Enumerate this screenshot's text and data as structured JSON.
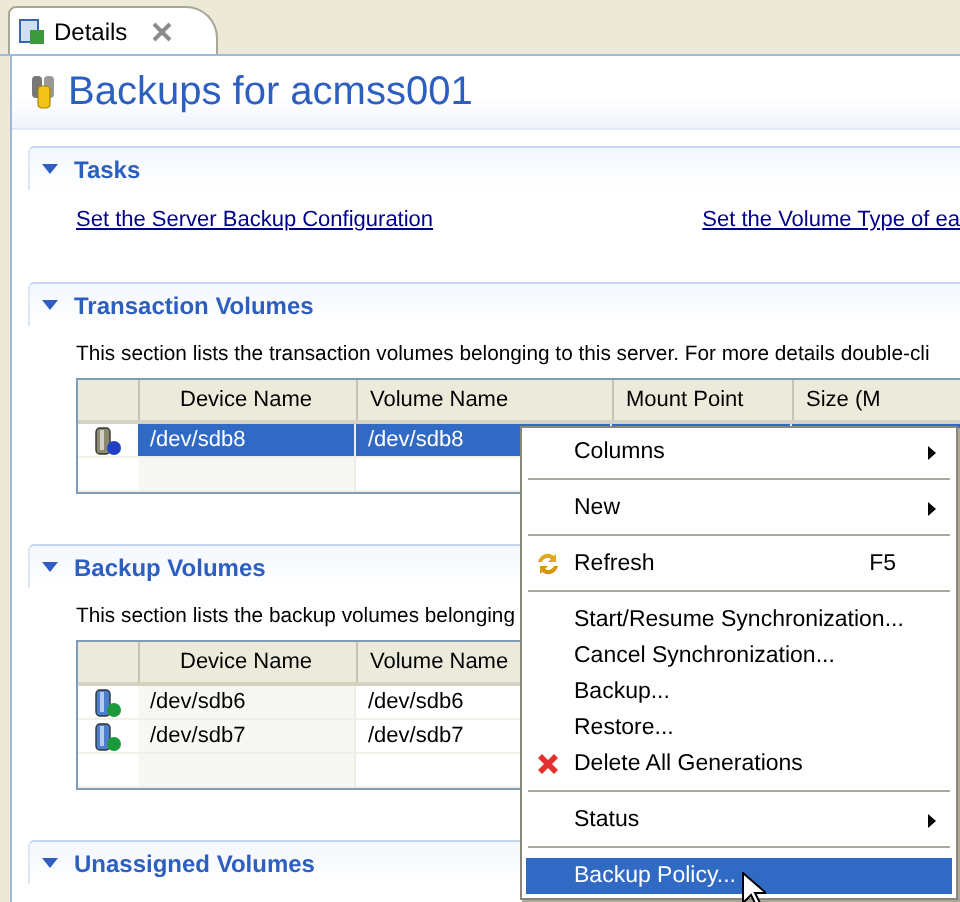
{
  "tab": {
    "label": "Details",
    "selected": true
  },
  "page_title": "Backups for acmss001",
  "sections": [
    {
      "kind": "tasks",
      "title": "Tasks",
      "expanded": true,
      "links": [
        "Set the Server Backup Configuration",
        "Set the Volume Type of ea"
      ]
    },
    {
      "kind": "transaction",
      "title": "Transaction Volumes",
      "expanded": true,
      "description": "This section lists the transaction volumes belonging to this server. For more details double-cli",
      "columns": [
        "Device Name",
        "Volume Name",
        "Mount Point",
        "Size (M"
      ],
      "rows": [
        {
          "selected": true,
          "cells": [
            "/dev/sdb8",
            "/dev/sdb8"
          ]
        }
      ]
    },
    {
      "kind": "backup",
      "title": "Backup Volumes",
      "expanded": true,
      "description": "This section lists the backup volumes belonging",
      "columns": [
        "Device Name",
        "Volume Name"
      ],
      "rows": [
        {
          "selected": false,
          "cells": [
            "/dev/sdb6",
            "/dev/sdb6"
          ]
        },
        {
          "selected": false,
          "cells": [
            "/dev/sdb7",
            "/dev/sdb7"
          ]
        }
      ]
    },
    {
      "kind": "unassigned",
      "title": "Unassigned Volumes",
      "expanded": true
    }
  ],
  "context_menu": [
    {
      "kind": "submenu",
      "label": "Columns",
      "selected": false
    },
    {
      "kind": "separator"
    },
    {
      "kind": "submenu",
      "label": "New",
      "selected": false
    },
    {
      "kind": "separator"
    },
    {
      "kind": "refresh",
      "label": "Refresh",
      "shortcut": "F5",
      "selected": false
    },
    {
      "kind": "separator"
    },
    {
      "kind": "item",
      "label": "Start/Resume Synchronization...",
      "selected": false
    },
    {
      "kind": "item",
      "label": "Cancel Synchronization...",
      "selected": false
    },
    {
      "kind": "item",
      "label": "Backup...",
      "selected": false
    },
    {
      "kind": "item",
      "label": "Restore...",
      "selected": false
    },
    {
      "kind": "delete",
      "label": "Delete All Generations",
      "selected": false
    },
    {
      "kind": "separator"
    },
    {
      "kind": "submenu",
      "label": "Status",
      "selected": false
    },
    {
      "kind": "separator"
    },
    {
      "kind": "item",
      "label": "Backup Policy...",
      "selected": true
    }
  ]
}
